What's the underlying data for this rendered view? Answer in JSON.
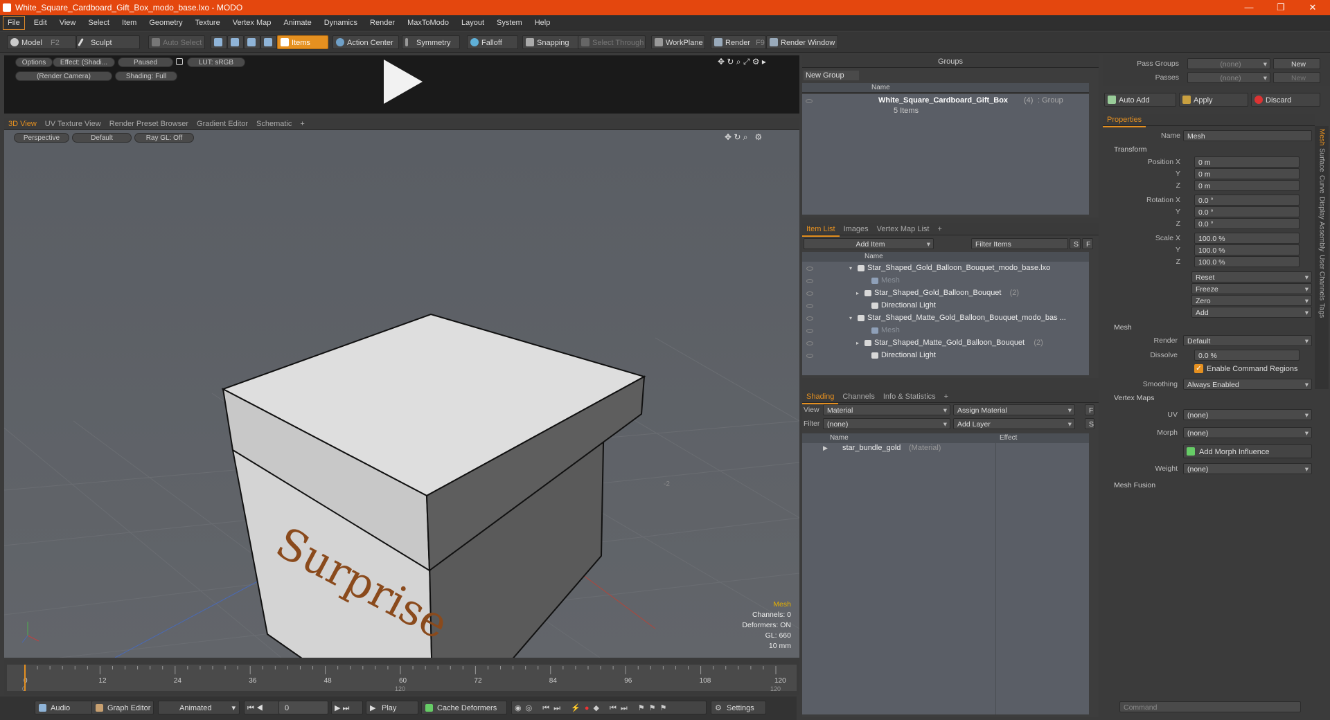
{
  "window": {
    "title": "White_Square_Cardboard_Gift_Box_modo_base.lxo - MODO"
  },
  "menu": [
    "File",
    "Edit",
    "View",
    "Select",
    "Item",
    "Geometry",
    "Texture",
    "Vertex Map",
    "Animate",
    "Dynamics",
    "Render",
    "MaxToModo",
    "Layout",
    "System",
    "Help"
  ],
  "toolbar": {
    "model": "Model",
    "model_key": "F2",
    "sculpt": "Sculpt",
    "auto_select": "Auto Select",
    "items": "Items",
    "action_center": "Action Center",
    "symmetry": "Symmetry",
    "falloff": "Falloff",
    "snapping": "Snapping",
    "select_through": "Select Through",
    "workplane": "WorkPlane",
    "render": "Render",
    "render_key": "F9",
    "render_window": "Render Window"
  },
  "preview": {
    "options": "Options",
    "effect": "Effect: (Shadi...",
    "paused": "Paused",
    "lut": "LUT: sRGB",
    "camera": "(Render Camera)",
    "shading": "Shading: Full"
  },
  "viewport_tabs": [
    "3D View",
    "UV Texture View",
    "Render Preset Browser",
    "Gradient Editor",
    "Schematic"
  ],
  "viewport": {
    "perspective": "Perspective",
    "default": "Default",
    "raygl": "Ray GL: Off",
    "label_text": "Surprise",
    "minus2": "-2",
    "info": {
      "mesh": "Mesh",
      "channels": "Channels: 0",
      "deformers": "Deformers: ON",
      "gl": "GL: 660",
      "scale": "10 mm"
    }
  },
  "timeline": {
    "ticks": [
      "0",
      "12",
      "24",
      "36",
      "48",
      "60",
      "72",
      "84",
      "96",
      "108",
      "120"
    ],
    "sub_left": "0",
    "sub_mid": "120",
    "sub_right": "120"
  },
  "bottombar": {
    "audio": "Audio",
    "graph_editor": "Graph Editor",
    "animated": "Animated",
    "frame": "0",
    "play": "Play",
    "cache": "Cache Deformers",
    "settings": "Settings"
  },
  "groups": {
    "title": "Groups",
    "new_group": "New Group",
    "col_name": "Name",
    "item_name": "White_Square_Cardboard_Gift_Box",
    "item_count": "(4)",
    "item_type": ": Group",
    "item_sub": "5 Items"
  },
  "itemlist": {
    "tabs": [
      "Item List",
      "Images",
      "Vertex Map List"
    ],
    "add_item": "Add Item",
    "filter": "Filter Items",
    "s": "S",
    "f": "F",
    "col_name": "Name",
    "rows": [
      {
        "label": "Star_Shaped_Gold_Balloon_Bouquet_modo_base.lxo",
        "count": "",
        "dim": false,
        "indent": 0
      },
      {
        "label": "Mesh",
        "count": "",
        "dim": true,
        "indent": 2
      },
      {
        "label": "Star_Shaped_Gold_Balloon_Bouquet",
        "count": "(2)",
        "dim": false,
        "indent": 1
      },
      {
        "label": "Directional Light",
        "count": "",
        "dim": false,
        "indent": 2
      },
      {
        "label": "Star_Shaped_Matte_Gold_Balloon_Bouquet_modo_bas ...",
        "count": "",
        "dim": false,
        "indent": 0
      },
      {
        "label": "Mesh",
        "count": "",
        "dim": true,
        "indent": 2
      },
      {
        "label": "Star_Shaped_Matte_Gold_Balloon_Bouquet",
        "count": "(2)",
        "dim": false,
        "indent": 1
      },
      {
        "label": "Directional Light",
        "count": "",
        "dim": false,
        "indent": 2
      }
    ]
  },
  "shading": {
    "tabs": [
      "Shading",
      "Channels",
      "Info & Statistics"
    ],
    "view_label": "View",
    "view_value": "Material",
    "assign": "Assign Material",
    "f": "F",
    "filter_label": "Filter",
    "filter_value": "(none)",
    "add_layer": "Add Layer",
    "s": "S",
    "col_name": "Name",
    "col_effect": "Effect",
    "item": "star_bundle_gold",
    "item_type": "(Material)"
  },
  "passes": {
    "pass_groups": "Pass Groups",
    "passes": "Passes",
    "none1": "(none)",
    "none2": "(none)",
    "new1": "New",
    "new2": "New"
  },
  "actions": {
    "auto_add": "Auto Add",
    "apply": "Apply",
    "discard": "Discard"
  },
  "properties": {
    "tab": "Properties",
    "name_label": "Name",
    "name_value": "Mesh",
    "transform": "Transform",
    "position_label": "Position X",
    "y": "Y",
    "z": "Z",
    "pos": [
      "0 m",
      "0 m",
      "0 m"
    ],
    "rotation_label": "Rotation X",
    "rot": [
      "0.0 °",
      "0.0 °",
      "0.0 °"
    ],
    "scale_label": "Scale X",
    "scl": [
      "100.0 %",
      "100.0 %",
      "100.0 %"
    ],
    "reset": "Reset",
    "freeze": "Freeze",
    "zero": "Zero",
    "add": "Add",
    "mesh": "Mesh",
    "render_label": "Render",
    "render_value": "Default",
    "dissolve_label": "Dissolve",
    "dissolve_value": "0.0 %",
    "ecr": "Enable Command Regions",
    "smoothing_label": "Smoothing",
    "smoothing_value": "Always Enabled",
    "vertex_maps": "Vertex Maps",
    "uv_label": "UV",
    "uv_value": "(none)",
    "morph_label": "Morph",
    "morph_value": "(none)",
    "add_morph": "Add Morph Influence",
    "weight_label": "Weight",
    "weight_value": "(none)",
    "mesh_fusion": "Mesh Fusion",
    "side_tabs": [
      "Mesh",
      "Surface",
      "Curve",
      "Display",
      "Assembly",
      "User Channels",
      "Tags"
    ]
  },
  "command": {
    "placeholder": "Command"
  },
  "colors": {
    "accent": "#e59020",
    "title": "#e4470e",
    "box_light": "#d6d6d6",
    "box_dark": "#5e5e5e",
    "text_brown": "#8a4a1c"
  }
}
